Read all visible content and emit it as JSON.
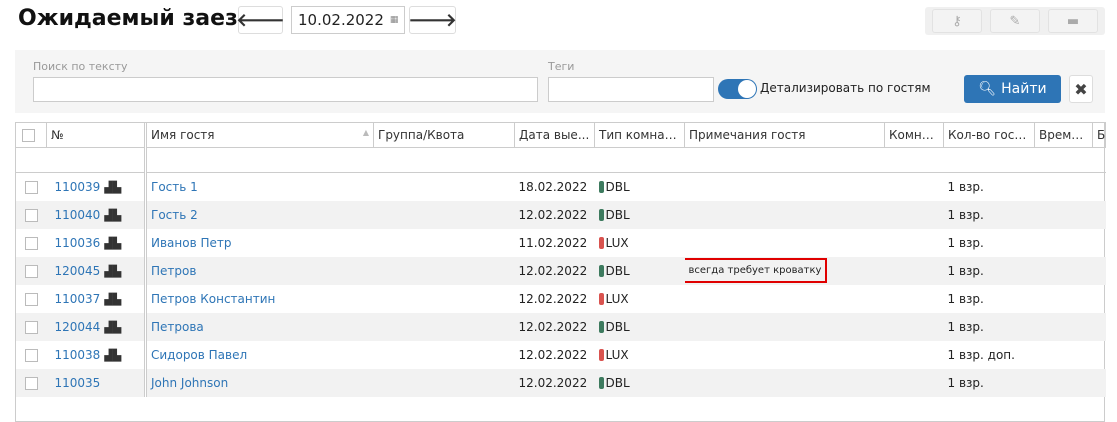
{
  "header": {
    "title": "Ожидаемый заезд",
    "date": "10.02.2022",
    "prev_icon": "arrow-left-icon",
    "next_icon": "arrow-right-icon",
    "toolbar_icons": [
      "key-icon",
      "edit-icon",
      "bed-icon"
    ]
  },
  "filters": {
    "search_label": "Поиск по тексту",
    "search_value": "",
    "tags_label": "Теги",
    "tags_value": "",
    "detail_toggle": {
      "label": "Детализировать по гостям",
      "on": true
    },
    "find_label": "Найти",
    "clear_icon": "close-icon"
  },
  "colors": {
    "accent": "#2e75b6",
    "DBL": "#3d7a5e",
    "LUX": "#d9534f",
    "highlight": "#e00000"
  },
  "table": {
    "columns": [
      "№",
      "Имя гостя",
      "Группа/Квота",
      "Дата вые...",
      "Тип комнаты",
      "Примечания гостя",
      "Комна...",
      "Кол-во гост...",
      "Время...",
      "Б"
    ],
    "rows": [
      {
        "id": "110039",
        "group": true,
        "name": "Гость 1",
        "quota": "",
        "date": "18.02.2022",
        "type": "DBL",
        "note": "",
        "room": "",
        "guests": "1 взр."
      },
      {
        "id": "110040",
        "group": true,
        "name": "Гость 2",
        "quota": "",
        "date": "12.02.2022",
        "type": "DBL",
        "note": "",
        "room": "",
        "guests": "1 взр."
      },
      {
        "id": "110036",
        "group": true,
        "name": "Иванов Петр",
        "quota": "",
        "date": "11.02.2022",
        "type": "LUX",
        "note": "",
        "room": "",
        "guests": "1 взр."
      },
      {
        "id": "120045",
        "group": true,
        "name": "Петров",
        "quota": "",
        "date": "12.02.2022",
        "type": "DBL",
        "note": "всегда требует кроватку",
        "room": "",
        "guests": "1 взр."
      },
      {
        "id": "110037",
        "group": true,
        "name": "Петров Константин",
        "quota": "",
        "date": "12.02.2022",
        "type": "LUX",
        "note": "",
        "room": "",
        "guests": "1 взр."
      },
      {
        "id": "120044",
        "group": true,
        "name": "Петрова",
        "quota": "",
        "date": "12.02.2022",
        "type": "DBL",
        "note": "",
        "room": "",
        "guests": "1 взр."
      },
      {
        "id": "110038",
        "group": true,
        "name": "Сидоров Павел",
        "quota": "",
        "date": "12.02.2022",
        "type": "LUX",
        "note": "",
        "room": "",
        "guests": "1 взр. доп."
      },
      {
        "id": "110035",
        "group": false,
        "name": "John Johnson",
        "quota": "",
        "date": "12.02.2022",
        "type": "DBL",
        "note": "",
        "room": "",
        "guests": "1 взр."
      }
    ]
  }
}
